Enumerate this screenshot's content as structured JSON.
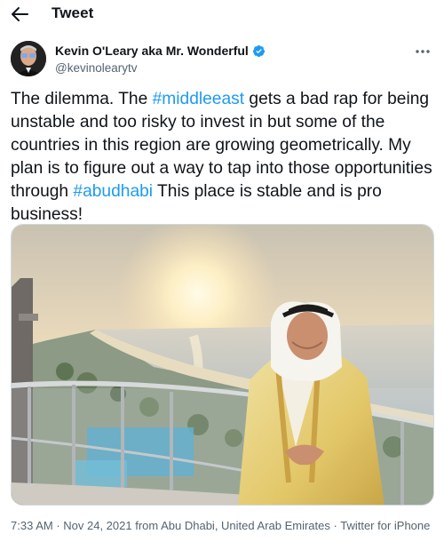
{
  "header": {
    "title": "Tweet",
    "back_icon": "arrow-left-icon"
  },
  "author": {
    "display_name": "Kevin O'Leary aka Mr. Wonderful",
    "handle": "@kevinolearytv",
    "verified": true,
    "verified_color": "#1d9bf0",
    "more_icon": "more-horizontal-icon"
  },
  "tweet": {
    "text_1": "The dilemma. The ",
    "hashtag_1": "#middleeast",
    "text_2": " gets a bad rap for being unstable and too risky to invest in but some of the countries in this region are growing geometrically. My plan is to figure out a way to tap into those opportunities through ",
    "hashtag_2": "#abudhabi",
    "text_3": " This place is stable and is pro business!",
    "link_color": "#1d9bf0"
  },
  "media": {
    "kind": "photo"
  },
  "meta": {
    "time": "7:33 AM",
    "sep_1": " · ",
    "date": "Nov 24, 2021",
    "location": " from Abu Dhabi, United Arab Emirates",
    "sep_2": " · ",
    "source": "Twitter for iPhone"
  }
}
